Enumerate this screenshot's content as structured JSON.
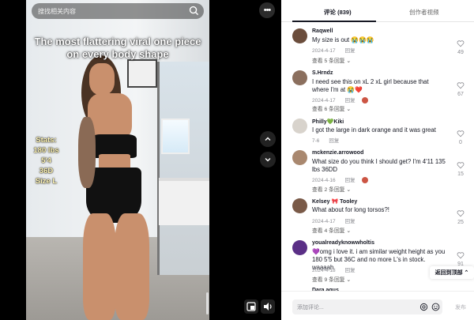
{
  "video": {
    "search_placeholder": "搜找相关内容",
    "caption": "The most flattering viral one piece on every body shape",
    "stats": [
      "Stats:",
      "180 lbs",
      "5'4",
      "36D",
      "Size L"
    ]
  },
  "panel": {
    "tabs": [
      {
        "label": "评论 (839)",
        "active": true
      },
      {
        "label": "创作者视频",
        "active": false
      }
    ],
    "comments": [
      {
        "name": "Raqwell",
        "text": "My size is out 😭😭😭",
        "date": "2024-4-17",
        "reply": "回复",
        "more": "查看 5 条回复 ⌄",
        "likes": "49",
        "avatar_color": "#6b4d3c"
      },
      {
        "name": "S.Hrndz",
        "text": "I need see this on xL 2 xL girl because that where I'm at 😭❤️",
        "date": "2024-4-17",
        "reply": "回复",
        "more": "查看 6 条回复 ⌄",
        "likes": "67",
        "avatar_color": "#8b6f5e"
      },
      {
        "name": "Philly💚Kiki",
        "text": "I got the large in dark orange and it was great",
        "date": "7-6",
        "reply": "回复",
        "more": "",
        "likes": "0",
        "avatar_color": "#d8d3cc"
      },
      {
        "name": "mckenzie.arrowood",
        "text": "What size do you think I should get? I'm 4'11 135 lbs 36DD",
        "date": "2024-4-16",
        "reply": "回复",
        "more": "查看 2 条回复 ⌄",
        "likes": "15",
        "avatar_color": "#a9886f"
      },
      {
        "name": "Kelsey 🎀 Tooley",
        "text": "What about for long torsos?!",
        "date": "2024-4-17",
        "reply": "回复",
        "more": "查看 4 条回复 ⌄",
        "likes": "25",
        "avatar_color": "#7a5a48"
      },
      {
        "name": "youalreadyknowwholtis",
        "text": "💜omg i love it. i am similar weight height as you 180 5'5 but 36C and no more L's in stock. waaaah",
        "date": "2024-4-18",
        "reply": "回复",
        "more": "查看 9 条回复 ⌄",
        "likes": "91",
        "avatar_color": "#5a2f86"
      }
    ],
    "partial_name": "Dara.agus",
    "back_to_top": "返回到顶部 ⌃",
    "input_placeholder": "添加评论...",
    "send_label": "发布"
  },
  "colors": {
    "accent": "#fe2c55",
    "text": "#161823",
    "muted": "#8a8b91"
  }
}
